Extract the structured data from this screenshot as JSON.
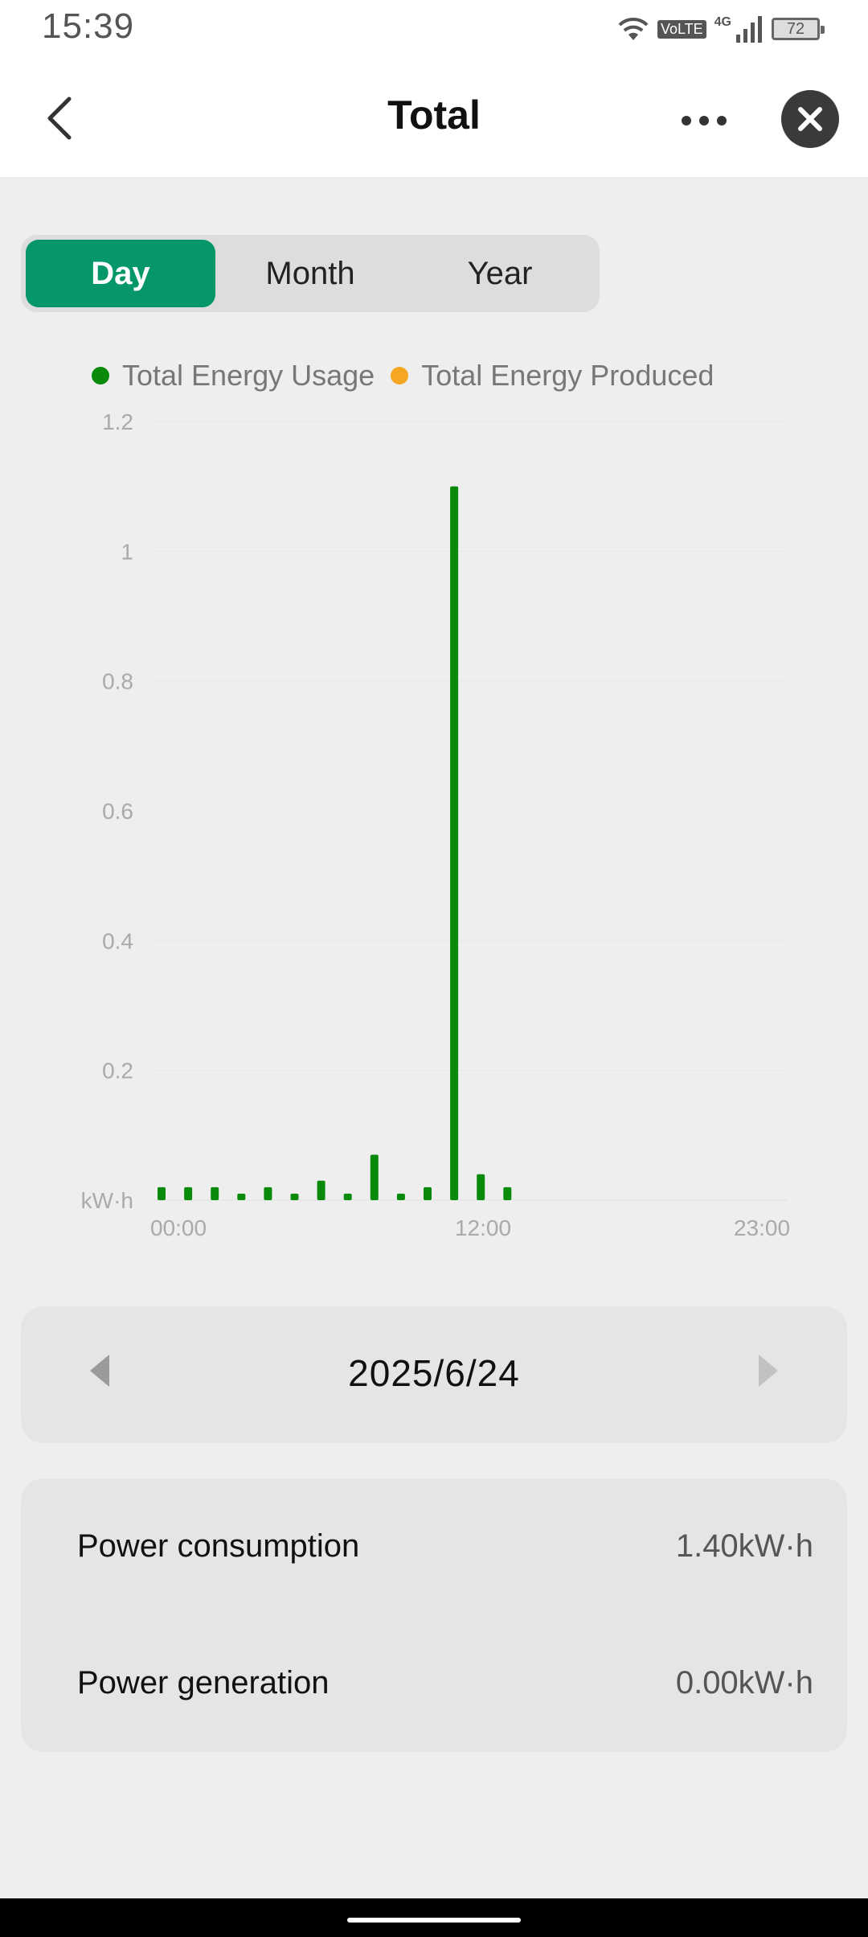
{
  "status_bar": {
    "time": "15:39",
    "network_volte": "VoLTE",
    "network_type": "4G",
    "battery": "72"
  },
  "header": {
    "title": "Total"
  },
  "tabs": [
    {
      "label": "Day",
      "active": true
    },
    {
      "label": "Month",
      "active": false
    },
    {
      "label": "Year",
      "active": false
    }
  ],
  "colors": {
    "accent": "#059669",
    "usage": "#0a8a0a",
    "produced": "#f5a623"
  },
  "chart_data": {
    "type": "bar",
    "legend": [
      "Total Energy Usage",
      "Total Energy Produced"
    ],
    "unit": "kW·h",
    "ylim": [
      0,
      1.2
    ],
    "y_ticks": [
      "1.2",
      "1",
      "0.8",
      "0.6",
      "0.4",
      "0.2"
    ],
    "x_ticks": [
      "00:00",
      "12:00",
      "23:00"
    ],
    "x": [
      0,
      1,
      2,
      3,
      4,
      5,
      6,
      7,
      8,
      9,
      10,
      11,
      12,
      13
    ],
    "series": [
      {
        "name": "Total Energy Usage",
        "values": [
          0.02,
          0.02,
          0.02,
          0.01,
          0.02,
          0.01,
          0.03,
          0.01,
          0.07,
          0.01,
          0.02,
          1.1,
          0.04,
          0.02
        ]
      },
      {
        "name": "Total Energy Produced",
        "values": [
          0,
          0,
          0,
          0,
          0,
          0,
          0,
          0,
          0,
          0,
          0,
          0,
          0,
          0
        ]
      }
    ],
    "grid": true,
    "legend_position": "top"
  },
  "date_nav": {
    "date": "2025/6/24"
  },
  "stats": [
    {
      "label": "Power consumption",
      "value": "1.40kW·h"
    },
    {
      "label": "Power generation",
      "value": "0.00kW·h"
    }
  ]
}
